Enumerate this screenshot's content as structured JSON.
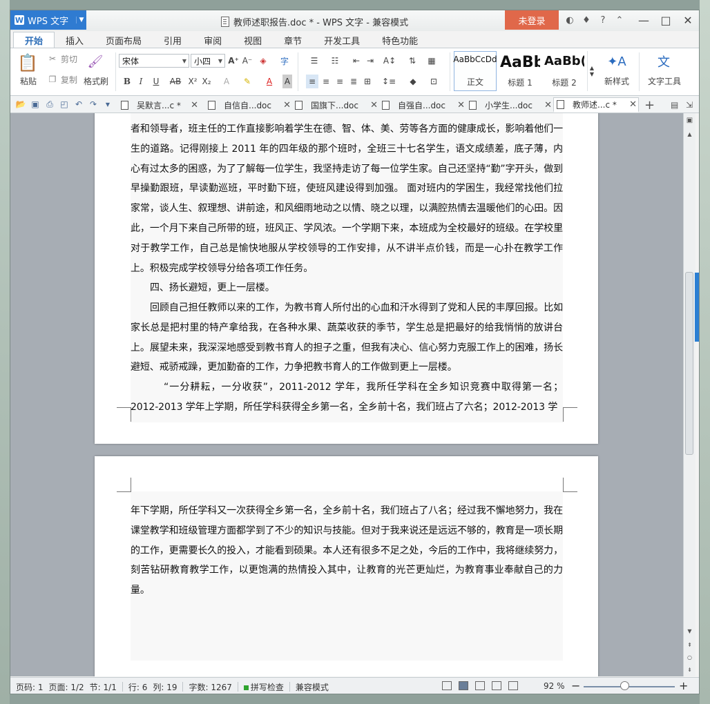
{
  "titlebar": {
    "app_name": "WPS 文字",
    "doc_title": "教师述职报告.doc * - WPS 文字 - 兼容模式",
    "login": "未登录"
  },
  "menu_tabs": [
    "开始",
    "插入",
    "页面布局",
    "引用",
    "审阅",
    "视图",
    "章节",
    "开发工具",
    "特色功能"
  ],
  "ribbon": {
    "paste": "粘贴",
    "cut": "剪切",
    "copy": "复制",
    "format_painter": "格式刷",
    "font_name": "宋体",
    "font_size": "小四",
    "styles": [
      {
        "sample": "AaBbCcDd",
        "label": "正文"
      },
      {
        "sample": "AaBb",
        "label": "标题 1"
      },
      {
        "sample": "AaBb(",
        "label": "标题 2"
      }
    ],
    "new_style": "新样式",
    "text_tool": "文字工具"
  },
  "doc_tabs": [
    {
      "label": "吴默言...c *",
      "active": false
    },
    {
      "label": "自信自...doc",
      "active": false
    },
    {
      "label": "国旗下...doc",
      "active": false
    },
    {
      "label": "自强自...doc",
      "active": false
    },
    {
      "label": "小学生...doc",
      "active": false
    },
    {
      "label": "教师述...c *",
      "active": true
    }
  ],
  "page1": {
    "paragraphs": [
      "者和领导者，班主任的工作直接影响着学生在德、智、体、美、劳等各方面的健康成长，影响着他们一生的道路。记得刚接上 2011 年的四年级的那个班时，全班三十七名学生，语文成绩差，底子薄，内心有过太多的困惑，为了了解每一位学生，我坚持走访了每一位学生家。自己还坚持“勤”字开头，做到早操勤跟班，早读勤巡班，平时勤下班，使班风建设得到加强。 面对班内的学困生，我经常找他们拉家常，谈人生、叙理想、讲前途，和风细雨地动之以情、晓之以理，以满腔热情去温暖他们的心田。因此，一个月下来自己所带的班，班风正、学风浓。一个学期下来，本班成为全校最好的班级。在学校里对于教学工作，自己总是愉快地服从学校领导的工作安排，从不讲半点价钱，而是一心扑在教学工作上。积极完成学校领导分给各项工作任务。",
      "四、扬长避短，更上一层楼。",
      "回顾自己担任教师以来的工作，为教书育人所付出的心血和汗水得到了党和人民的丰厚回报。比如家长总是把村里的特产拿给我，在各种水果、蔬菜收获的季节，学生总是把最好的给我悄悄的放讲台上。展望未来，我深深地感受到教书育人的担子之重，但我有决心、信心努力克服工作上的困难，扬长避短、戒骄戒躁，更加勤奋的工作，力争把教书育人的工作做到更上一层楼。",
      "“一分耕耘，一分收获”，2011-2012 学年，我所任学科在全乡知识竞赛中取得第一名；2012-2013 学年上学期，所任学科获得全乡第一名，全乡前十名，我们班占了六名；2012-2013 学"
    ]
  },
  "page2": {
    "paragraphs": [
      "年下学期，所任学科又一次获得全乡第一名，全乡前十名，我们班占了八名；经过我不懈地努力，我在课堂教学和班级管理方面都学到了不少的知识与技能。但对于我来说还是远远不够的，教育是一项长期的工作，更需要长久的投入，才能看到硕果。本人还有很多不足之处，今后的工作中，我将继续努力，刻苦钻研教育教学工作，以更饱满的热情投入其中，让教育的光芒更灿烂，为教育事业奉献自己的力量。"
    ]
  },
  "statusbar": {
    "page_num": "页码: 1",
    "pages": "页面: 1/2",
    "section": "节: 1/1",
    "row": "行: 6",
    "col": "列: 19",
    "word_count": "字数: 1267",
    "spell_check": "拼写检查",
    "compat_mode": "兼容模式",
    "zoom": "92 %"
  },
  "colors": {
    "app_blue": "#2f7bd1",
    "login_red": "#e0684a",
    "accent_tab": "#2b7fd3"
  }
}
